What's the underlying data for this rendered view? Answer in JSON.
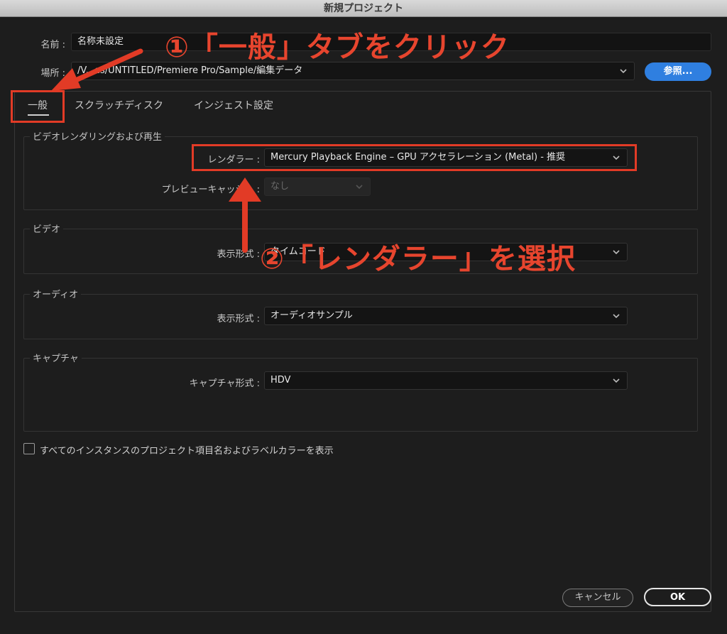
{
  "window": {
    "title": "新規プロジェクト"
  },
  "name_row": {
    "label": "名前 :",
    "value": "名称未設定"
  },
  "location_row": {
    "label": "場所 :",
    "value": "/V...es/UNTITLED/Premiere Pro/Sample/編集データ",
    "browse_label": "参照..."
  },
  "tabs": [
    {
      "label": "一般",
      "active": true
    },
    {
      "label": "スクラッチディスク",
      "active": false
    },
    {
      "label": "インジェスト設定",
      "active": false
    }
  ],
  "groups": {
    "video_render": {
      "title": "ビデオレンダリングおよび再生",
      "renderer_label": "レンダラー :",
      "renderer_value": "Mercury Playback Engine – GPU アクセラレーション (Metal) - 推奨",
      "preview_cache_label": "プレビューキャッシュ :",
      "preview_cache_value": "なし"
    },
    "video": {
      "title": "ビデオ",
      "display_label": "表示形式 :",
      "display_value": "タイムコード"
    },
    "audio": {
      "title": "オーディオ",
      "display_label": "表示形式 :",
      "display_value": "オーディオサンプル"
    },
    "capture": {
      "title": "キャプチャ",
      "format_label": "キャプチャ形式 :",
      "format_value": "HDV"
    }
  },
  "checkbox": {
    "label": "すべてのインスタンスのプロジェクト項目名およびラベルカラーを表示",
    "checked": false
  },
  "buttons": {
    "cancel": "キャンセル",
    "ok": "OK"
  },
  "annotations": {
    "step1": "①「一般」タブをクリック",
    "step2": "②「レンダラー」を選択",
    "color": "#e23b26"
  }
}
